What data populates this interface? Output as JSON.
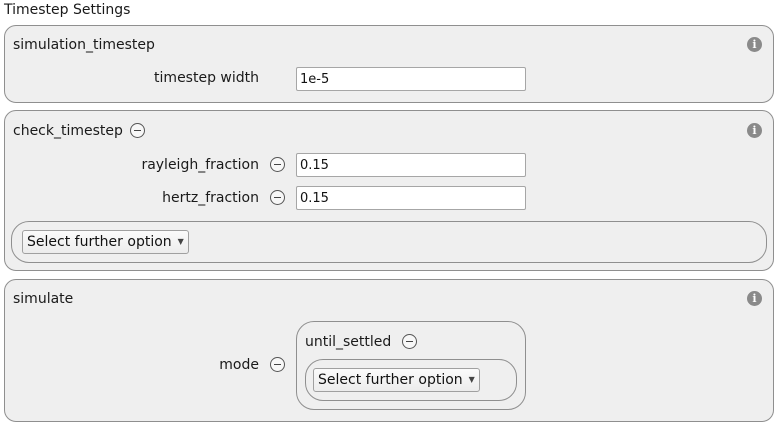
{
  "page": {
    "title": "Timestep Settings"
  },
  "simulation_timestep": {
    "title": "simulation_timestep",
    "timestep_width": {
      "label": "timestep width",
      "value": "1e-5"
    }
  },
  "check_timestep": {
    "title": "check_timestep",
    "rayleigh_fraction": {
      "label": "rayleigh_fraction",
      "value": "0.15"
    },
    "hertz_fraction": {
      "label": "hertz_fraction",
      "value": "0.15"
    },
    "further_option": {
      "label": "Select further option"
    }
  },
  "simulate": {
    "title": "simulate",
    "mode": {
      "label": "mode",
      "selected_title": "until_settled",
      "further_option": {
        "label": "Select further option"
      }
    }
  },
  "icons": {
    "info": "i"
  }
}
